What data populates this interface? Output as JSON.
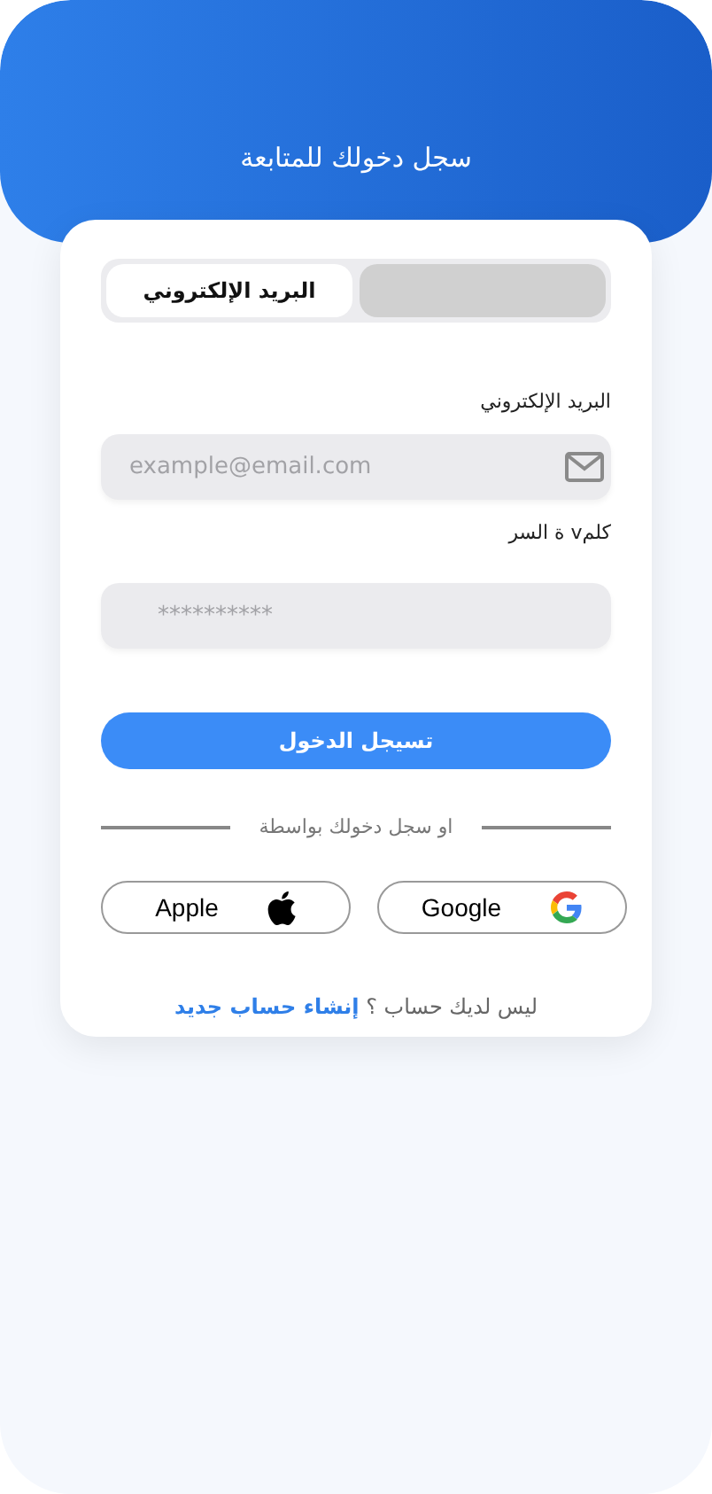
{
  "header": {
    "title": "سجل دخولك للمتابعة"
  },
  "tabs": [
    {
      "label": "البريد الإلكتروني",
      "selected": true
    },
    {
      "selected": false
    }
  ],
  "fields": [
    {
      "kind": "email",
      "label": "البريد الإلكتروني",
      "placeholder": "example@email.com"
    },
    {
      "kind": "password",
      "label": "كلمv ة السر",
      "placeholder": "**********"
    }
  ],
  "login_button": "تسيجل الدخول",
  "divider_text": "او سجل دخولك بواسطة",
  "social_buttons": [
    {
      "kind": "google",
      "label": "Google"
    },
    {
      "kind": "apple",
      "label": "Apple"
    }
  ],
  "footer": {
    "text": "ليس لديك حساب ؟",
    "link": "إنشاء حساب جديد"
  }
}
